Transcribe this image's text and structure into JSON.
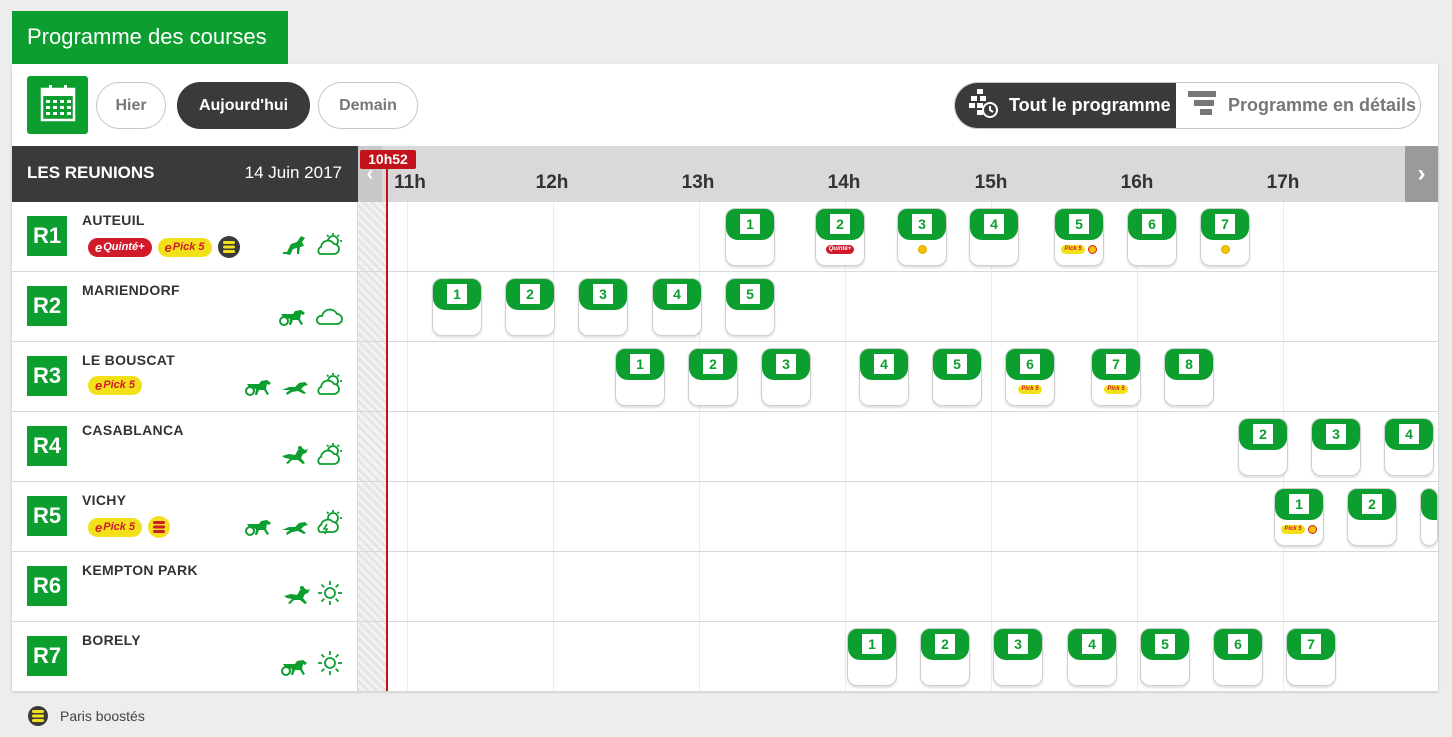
{
  "page": {
    "title": "Programme des courses"
  },
  "days": [
    {
      "label": "Hier",
      "active": false
    },
    {
      "label": "Aujourd'hui",
      "active": true
    },
    {
      "label": "Demain",
      "active": false
    }
  ],
  "views": {
    "all": {
      "label": "Tout le programme",
      "active": true
    },
    "details": {
      "label": "Programme en détails",
      "active": false
    }
  },
  "reunions_header": {
    "label": "LES REUNIONS",
    "date": "14 Juin 2017"
  },
  "timeline": {
    "now": "10h52",
    "hours": [
      "11h",
      "12h",
      "13h",
      "14h",
      "15h",
      "16h",
      "17h"
    ]
  },
  "colors": {
    "green": "#0c9e2f",
    "dark": "#3a3a3a",
    "now_red": "#c2121a",
    "pick5_yellow": "#f2e11a",
    "quinte_red": "#d11b2a"
  },
  "reunions": [
    {
      "code": "R1",
      "name": "AUTEUIL",
      "bets": [
        "E-Quinté+",
        "Pick 5",
        "boost"
      ],
      "icons": [
        "jump-icon",
        "cloudy-sun-icon"
      ],
      "races": [
        {
          "num": "1"
        },
        {
          "num": "2",
          "extras": [
            "quinte"
          ]
        },
        {
          "num": "3",
          "extras": [
            "boost"
          ]
        },
        {
          "num": "4"
        },
        {
          "num": "5",
          "extras": [
            "pick5",
            "boost-red"
          ]
        },
        {
          "num": "6"
        },
        {
          "num": "7",
          "extras": [
            "boost"
          ]
        }
      ]
    },
    {
      "code": "R2",
      "name": "MARIENDORF",
      "bets": [],
      "icons": [
        "trot-icon",
        "cloud-icon"
      ],
      "races": [
        {
          "num": "1"
        },
        {
          "num": "2"
        },
        {
          "num": "3"
        },
        {
          "num": "4"
        },
        {
          "num": "5"
        }
      ]
    },
    {
      "code": "R3",
      "name": "LE BOUSCAT",
      "bets": [
        "Pick 5"
      ],
      "icons": [
        "trot-icon",
        "gallop-icon",
        "cloudy-sun-icon"
      ],
      "races": [
        {
          "num": "1"
        },
        {
          "num": "2"
        },
        {
          "num": "3"
        },
        {
          "num": "4"
        },
        {
          "num": "5"
        },
        {
          "num": "6",
          "extras": [
            "pick5"
          ]
        },
        {
          "num": "7",
          "extras": [
            "pick5"
          ]
        },
        {
          "num": "8"
        }
      ]
    },
    {
      "code": "R4",
      "name": "CASABLANCA",
      "bets": [],
      "icons": [
        "flat-icon",
        "cloudy-sun-icon"
      ],
      "races": [
        {
          "num": "2"
        },
        {
          "num": "3"
        },
        {
          "num": "4"
        }
      ]
    },
    {
      "code": "R5",
      "name": "VICHY",
      "bets": [
        "Pick 5",
        "boost-red"
      ],
      "icons": [
        "trot-icon",
        "gallop-icon",
        "storm-icon"
      ],
      "races": [
        {
          "num": "1",
          "extras": [
            "pick5",
            "boost-red"
          ]
        },
        {
          "num": "2"
        },
        {
          "num": ""
        }
      ]
    },
    {
      "code": "R6",
      "name": "KEMPTON PARK",
      "bets": [],
      "icons": [
        "flat-icon",
        "sun-icon"
      ],
      "races": []
    },
    {
      "code": "R7",
      "name": "BORELY",
      "bets": [],
      "icons": [
        "trot-icon",
        "sun-icon"
      ],
      "races": [
        {
          "num": "1"
        },
        {
          "num": "2"
        },
        {
          "num": "3"
        },
        {
          "num": "4"
        },
        {
          "num": "5"
        },
        {
          "num": "6"
        },
        {
          "num": "7"
        }
      ]
    }
  ],
  "legend": {
    "label": "Paris boostés",
    "icon": "boost-icon"
  },
  "chip_text": {
    "quinte": "Quinté+",
    "pick5": "Pick 5",
    "mini_quinte": "Quinté+",
    "mini_pick5": "Pick 5"
  }
}
